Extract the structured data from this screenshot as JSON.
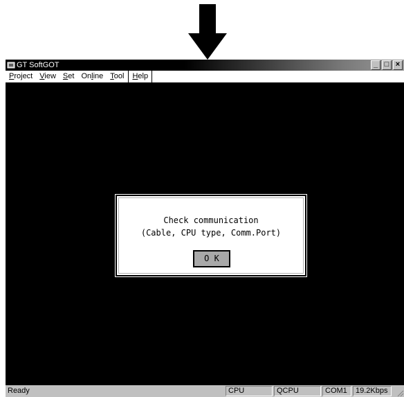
{
  "window": {
    "title": "GT SoftGOT",
    "minimize_glyph": "_",
    "maximize_glyph": "□",
    "close_glyph": "×"
  },
  "menu": {
    "items": [
      {
        "label": "Project",
        "accel": "P"
      },
      {
        "label": "View",
        "accel": "V"
      },
      {
        "label": "Set",
        "accel": "S"
      },
      {
        "label": "Online",
        "accel": "l"
      },
      {
        "label": "Tool",
        "accel": "T"
      },
      {
        "label": "Help",
        "accel": "H"
      }
    ]
  },
  "dialog": {
    "line1": "Check communication",
    "line2": "(Cable, CPU type, Comm.Port)",
    "ok_label": "O K"
  },
  "status": {
    "ready": "Ready",
    "cpu_label": "CPU",
    "cpu_type": "QCPU",
    "port": "COM1",
    "speed": "19.2Kbps"
  },
  "colors": {
    "screen_background": "#000000",
    "dialog_background": "#ffffff",
    "ok_button": "#a8a8a8",
    "window_chrome": "#c0c0c0"
  },
  "icons": [
    "down-arrow-icon",
    "app-icon",
    "minimize-icon",
    "maximize-icon",
    "close-icon",
    "resize-grip-icon"
  ]
}
